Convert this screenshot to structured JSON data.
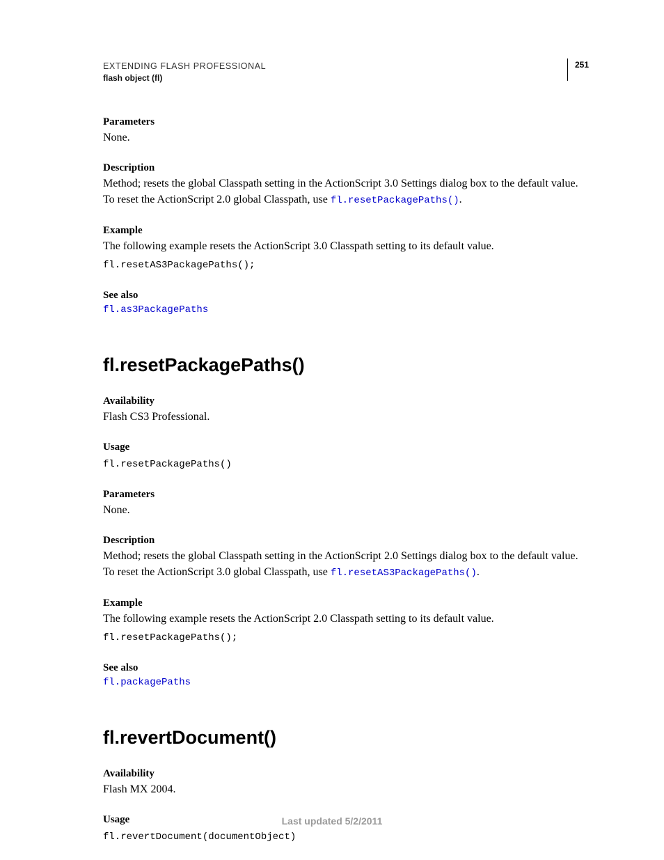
{
  "header": {
    "title": "EXTENDING FLASH PROFESSIONAL",
    "subtitle": "flash object (fl)",
    "page_number": "251"
  },
  "sec0": {
    "parameters_label": "Parameters",
    "parameters_text": "None.",
    "description_label": "Description",
    "description_text_a": "Method; resets the global Classpath setting in the ActionScript 3.0 Settings dialog box to the default value. To reset the ActionScript 2.0 global Classpath, use ",
    "description_link": "fl.resetPackagePaths()",
    "description_text_b": ".",
    "example_label": "Example",
    "example_text": "The following example resets the ActionScript 3.0 Classpath setting to its default value.",
    "example_code": "fl.resetAS3PackagePaths();",
    "seealso_label": "See also",
    "seealso_link": "fl.as3PackagePaths"
  },
  "sec1": {
    "heading": "fl.resetPackagePaths()",
    "availability_label": "Availability",
    "availability_text": "Flash CS3 Professional.",
    "usage_label": "Usage",
    "usage_code": "fl.resetPackagePaths()",
    "parameters_label": "Parameters",
    "parameters_text": "None.",
    "description_label": "Description",
    "description_text_a": "Method; resets the global Classpath setting in the ActionScript 2.0 Settings dialog box to the default value. To reset the ActionScript 3.0 global Classpath, use ",
    "description_link": "fl.resetAS3PackagePaths()",
    "description_text_b": ".",
    "example_label": "Example",
    "example_text": "The following example resets the ActionScript 2.0 Classpath setting to its default value.",
    "example_code": "fl.resetPackagePaths();",
    "seealso_label": "See also",
    "seealso_link": "fl.packagePaths"
  },
  "sec2": {
    "heading": "fl.revertDocument()",
    "availability_label": "Availability",
    "availability_text": "Flash MX 2004.",
    "usage_label": "Usage",
    "usage_code": "fl.revertDocument(documentObject)"
  },
  "footer": {
    "text": "Last updated 5/2/2011"
  }
}
